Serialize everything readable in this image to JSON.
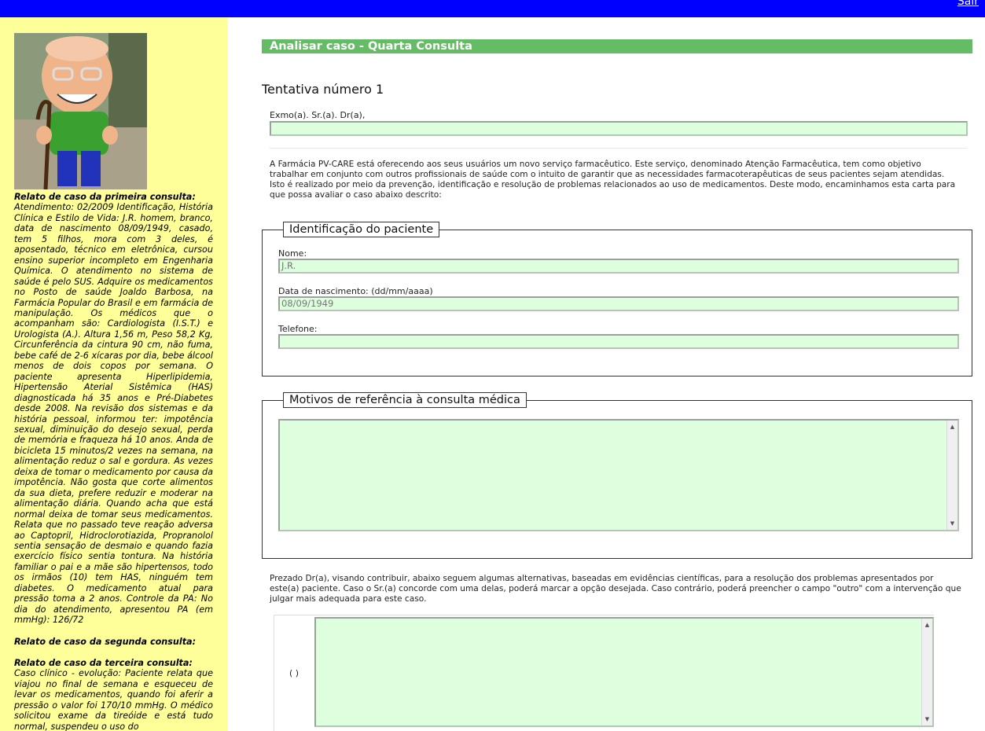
{
  "header": {
    "logout_label": "Sair"
  },
  "sidebar": {
    "avatar_icon": "patient-caricature-icon",
    "case1_title": "Relato de caso da primeira consulta:",
    "case1_text": "Atendimento: 02/2009 Identificação, História Clínica e Estilo de Vida: J.R. homem, branco, data de nascimento 08/09/1949, casado, tem 5 filhos, mora com 3 deles, é aposentado, técnico em eletrônica, cursou ensino superior incompleto em Engenharia Química. O atendimento no sistema de saúde é pelo SUS. Adquire os medicamentos no Posto de saúde Joaldo Barbosa, na Farmácia Popular do Brasil e em farmácia de manipulação. Os médicos que o acompanham são: Cardiologista (I.S.T.) e Urologista (A.). Altura 1,56 m, Peso 58,2 Kg, Circunferência da cintura 90 cm, não fuma, bebe café de 2-6 xícaras por dia, bebe álcool menos de dois copos por semana. O paciente apresenta Hiperlipidemia, Hipertensão Aterial Sistêmica (HAS) diagnosticada há 35 anos e Pré-Diabetes desde 2008. Na revisão dos sistemas e da história pessoal, informou ter: impotência sexual, diminuição do desejo sexual, perda de memória e fraqueza há 10 anos. Anda de bicicleta 15 minutos/2 vezes na semana, na alimentação reduz o sal e gordura. As vezes deixa de tomar o medicamento por causa da impotência. Não gosta que corte alimentos da sua dieta, prefere reduzir e moderar na alimentação diária. Quando acha que está normal deixa de tomar seus medicamentos. Relata que no passado teve reação adversa ao Captopril, Hidroclorotiazida, Propranolol sentia sensação de desmaio e quando fazia exercício físico sentia tontura. Na história familiar o pai e a mãe são hipertensos, todo os irmãos (10) tem HAS, ninguém tem diabetes. O medicamento atual para pressão toma a 2 anos. Controle da PA: No dia do atendimento, apresentou PA (em mmHg): 126/72",
    "case2_title": "Relato de caso da segunda consulta:",
    "case3_title": "Relato de caso da terceira consulta:",
    "case3_text": "Caso clínico - evolução: Paciente relata que viajou no final de semana e esqueceu de levar os medicamentos, quando foi aferir a pressão o valor foi 170/10 mmHg. O médico solicitou exame da tireóide e está tudo normal, suspendeu o uso do"
  },
  "main": {
    "title": "Analisar caso - Quarta Consulta",
    "attempt": "Tentativa número 1",
    "salutation_label": "Exmo(a). Sr.(a). Dr(a),",
    "salutation_value": "",
    "intro": "A Farmácia PV-CARE está oferecendo aos seus usuários um novo serviço farmacêutico. Este serviço, denominado Atenção Farmacêutica, tem como objetivo trabalhar em conjunto com outros profissionais de saúde com o intuito de garantir que as necessidades farmacoterapêuticas de seus pacientes sejam atendidas. Isto é realizado por meio da prevenção, identificação e resolução de problemas relacionados ao uso de medicamentos. Deste modo, encaminhamos esta carta para que possa avaliar o caso abaixo descrito:",
    "patient": {
      "legend": "Identificação do paciente",
      "name_label": "Nome:",
      "name_value": "J.R.",
      "dob_label": "Data de nascimento: (dd/mm/aaaa)",
      "dob_value": "08/09/1949",
      "phone_label": "Telefone:",
      "phone_value": ""
    },
    "reasons": {
      "legend": "Motivos de referência à consulta médica"
    },
    "prezado": "Prezado Dr(a), visando contribuir, abaixo seguem algumas alternativas, baseadas em evidências científicas, para a resolução dos problemas apresentados por este(a) paciente. Caso o Sr.(a) concorde com uma delas, poderá marcar a opção desejada. Caso contrário, poderá preencher o campo \"outro\" com a intervenção que julgar mais adequada para este caso.",
    "option_radio": "( )"
  }
}
